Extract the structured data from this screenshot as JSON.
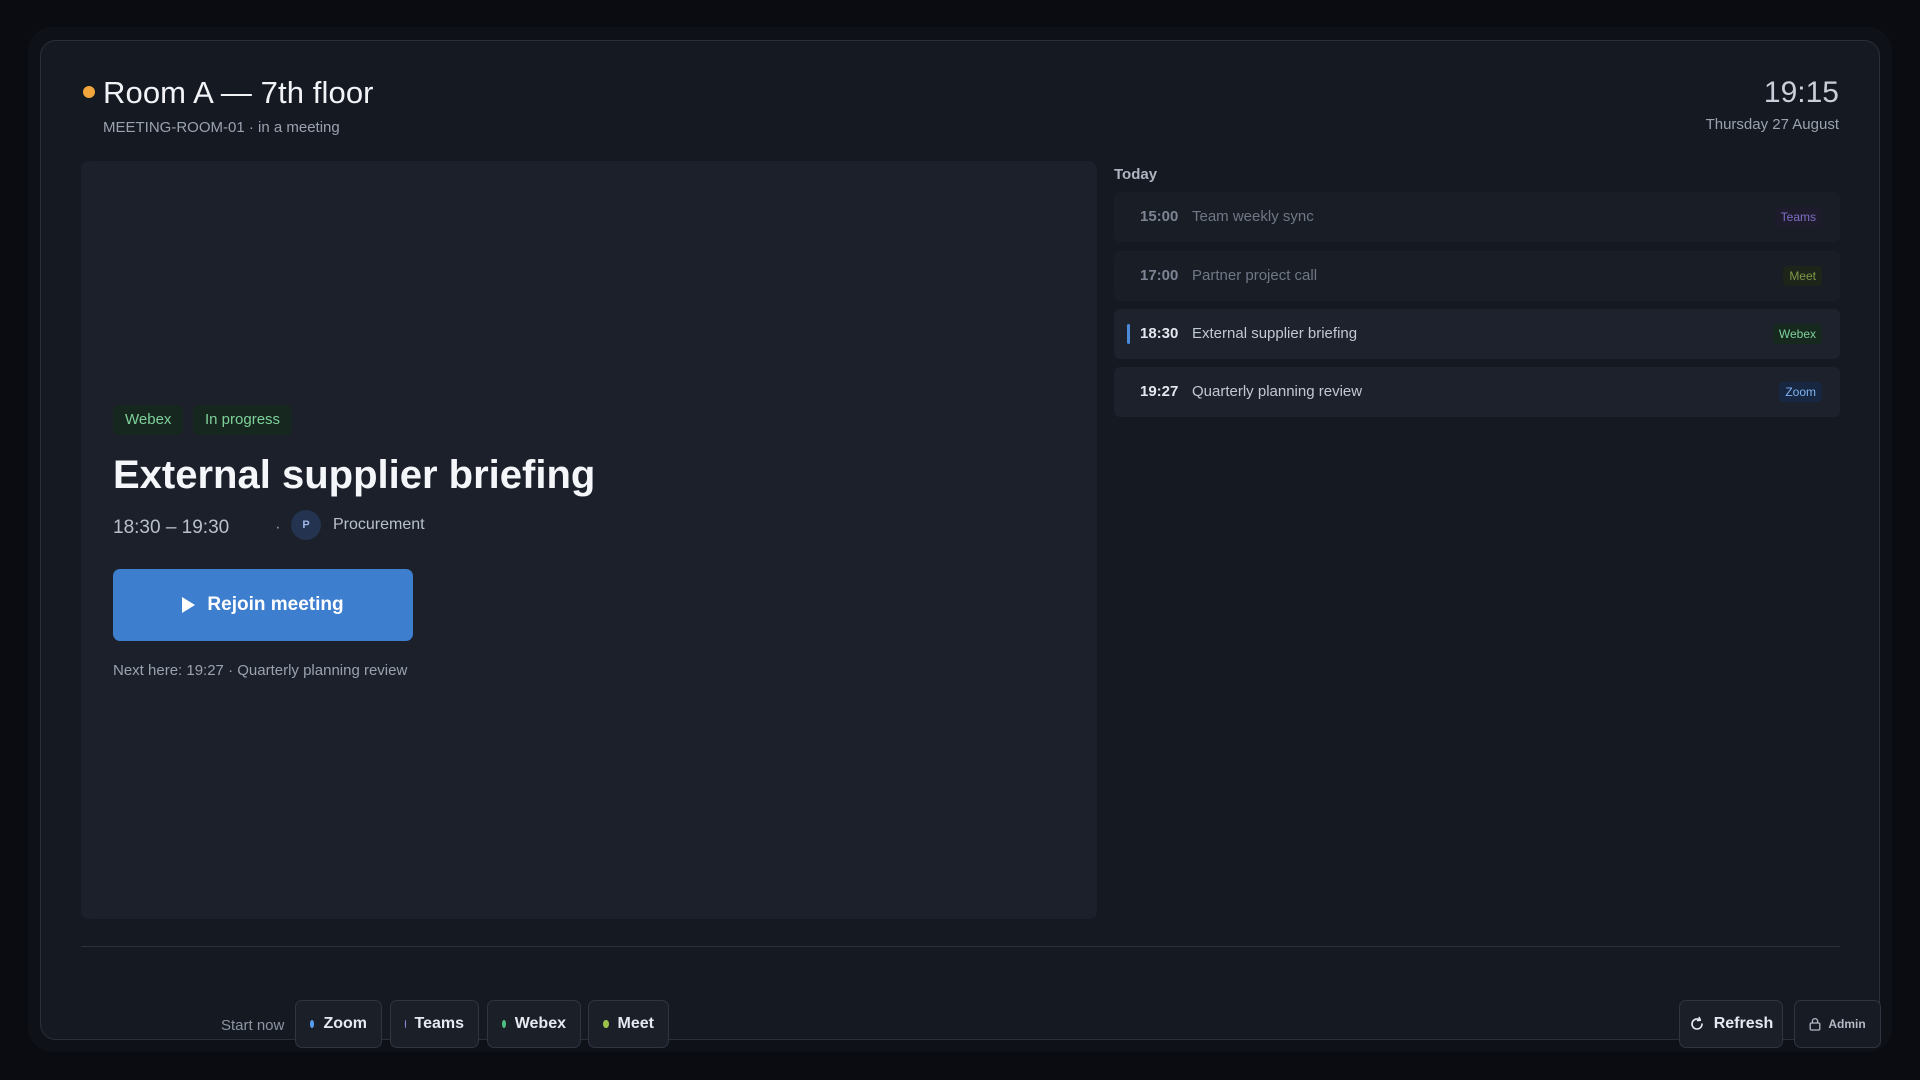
{
  "header": {
    "status_color": "#f0a63c",
    "room_title": "Room A — 7th floor",
    "room_subtitle": "MEETING-ROOM-01 · in a meeting",
    "clock": "19:15",
    "date": "Thursday 27 August"
  },
  "current_meeting": {
    "platform_tag": "Webex",
    "status_tag": "In progress",
    "title": "External supplier briefing",
    "time_range": "18:30 – 19:30",
    "separator": "·",
    "organizer_initial": "P",
    "organizer": "Procurement",
    "rejoin_label": "Rejoin meeting",
    "next_here": "Next here: 19:27 · Quarterly planning review"
  },
  "agenda": {
    "heading": "Today",
    "items": [
      {
        "time": "15:00",
        "title": "Team weekly sync",
        "platform": "Teams",
        "state": "past",
        "badge_color": "#7e6fc4",
        "badge_bg": "#1e1c2c"
      },
      {
        "time": "17:00",
        "title": "Partner project call",
        "platform": "Meet",
        "state": "past",
        "badge_color": "#7f9a47",
        "badge_bg": "#1d2419"
      },
      {
        "time": "18:30",
        "title": "External supplier briefing",
        "platform": "Webex",
        "state": "current",
        "badge_color": "#7fd19b",
        "badge_bg": "#17291f"
      },
      {
        "time": "19:27",
        "title": "Quarterly planning review",
        "platform": "Zoom",
        "state": "next",
        "badge_color": "#7fb4f2",
        "badge_bg": "#172641"
      }
    ]
  },
  "footer": {
    "start_now_label": "Start now",
    "platforms": [
      {
        "label": "Zoom",
        "color": "#5b9cf0"
      },
      {
        "label": "Teams",
        "color": "#9b8de0"
      },
      {
        "label": "Webex",
        "color": "#4cc07f"
      },
      {
        "label": "Meet",
        "color": "#9bc14a"
      }
    ],
    "refresh_label": "Refresh",
    "admin_label": "Admin"
  }
}
